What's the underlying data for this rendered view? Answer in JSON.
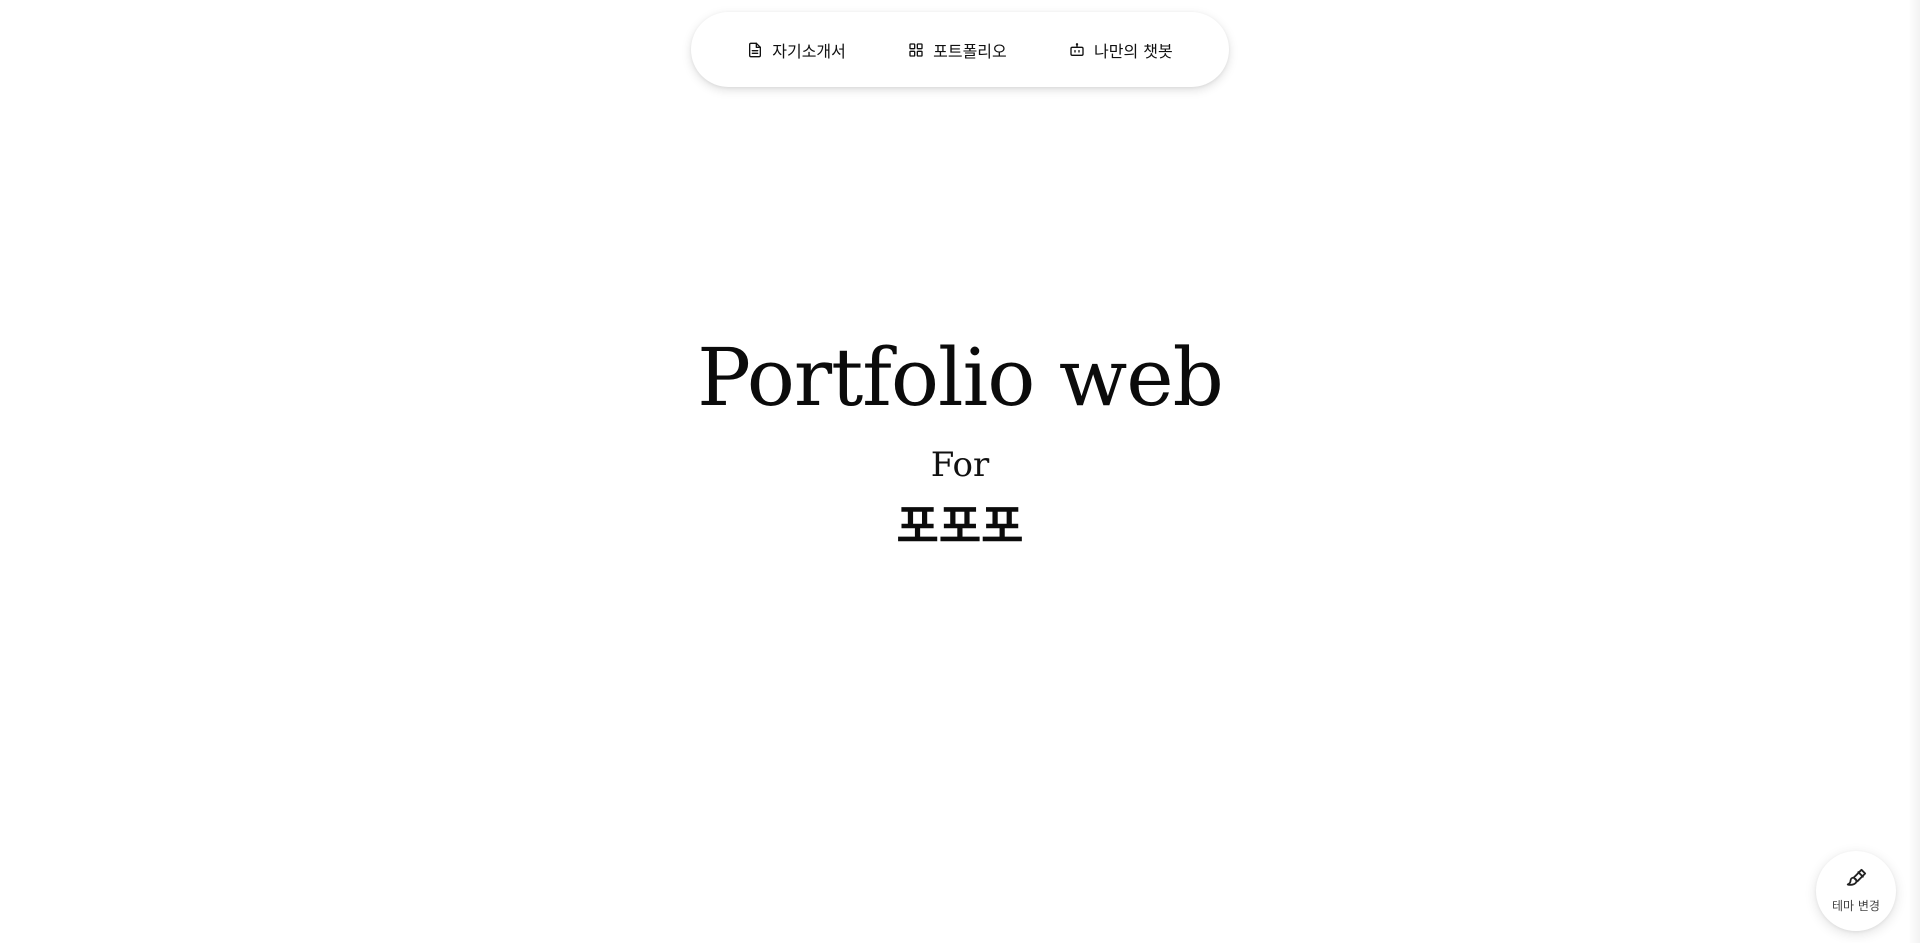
{
  "nav": {
    "items": [
      {
        "label": "자기소개서",
        "icon": "document-icon"
      },
      {
        "label": "포트폴리오",
        "icon": "grid-icon"
      },
      {
        "label": "나만의 챗봇",
        "icon": "bot-icon"
      }
    ]
  },
  "hero": {
    "title": "Portfolio web",
    "subtitle": "For",
    "name": "포포포"
  },
  "theme_button": {
    "label": "테마 변경",
    "icon": "paintbrush-icon"
  }
}
